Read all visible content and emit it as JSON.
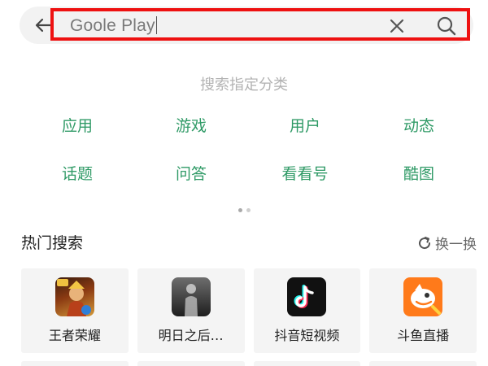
{
  "search": {
    "value": "Goole Play"
  },
  "categories": {
    "title": "搜索指定分类",
    "row1": [
      "应用",
      "游戏",
      "用户",
      "动态"
    ],
    "row2": [
      "话题",
      "问答",
      "看看号",
      "酷图"
    ]
  },
  "hot": {
    "title": "热门搜索",
    "refresh_label": "换一换",
    "apps": [
      {
        "name": "王者荣耀",
        "icon": "honor-of-kings-icon"
      },
      {
        "name": "明日之后…",
        "icon": "lifeafter-icon"
      },
      {
        "name": "抖音短视频",
        "icon": "douyin-icon"
      },
      {
        "name": "斗鱼直播",
        "icon": "douyu-icon"
      }
    ]
  },
  "colors": {
    "accent_green": "#2f9a66",
    "highlight_red": "#ee1111"
  }
}
